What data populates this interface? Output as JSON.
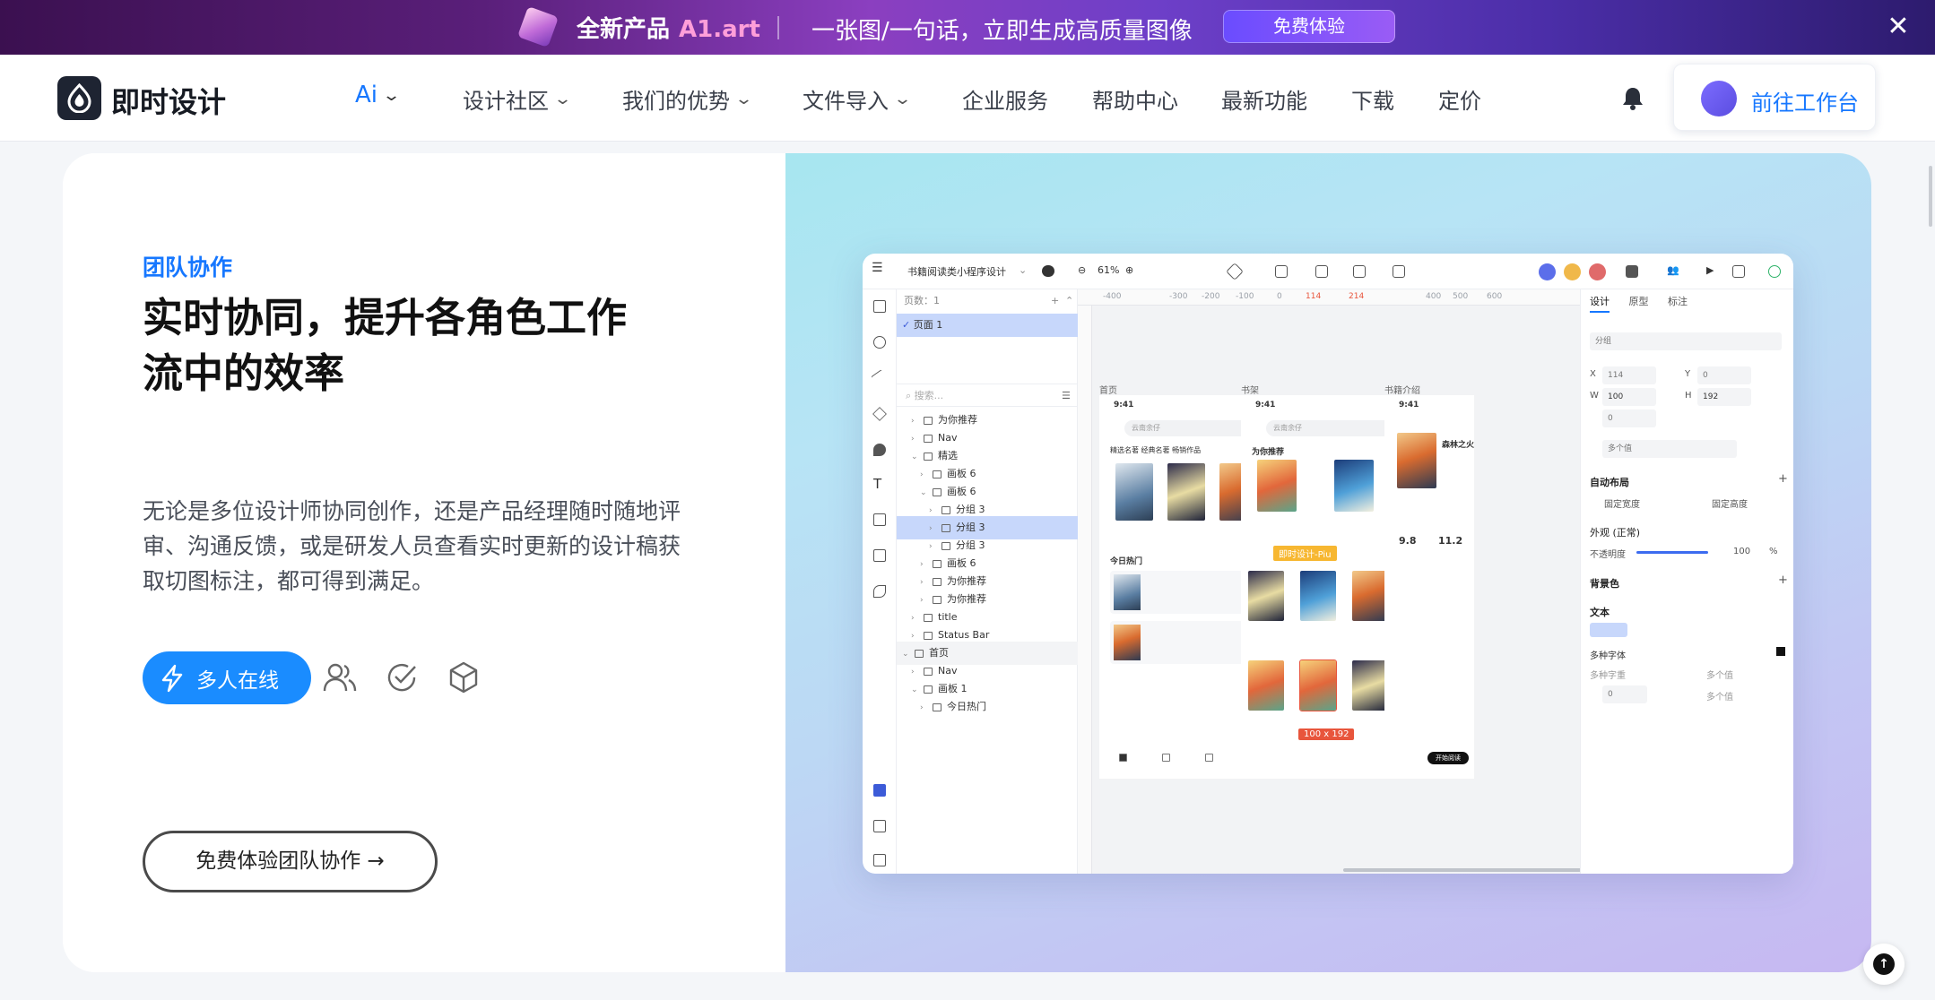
{
  "promo": {
    "title": "全新产品",
    "brand": "A1.art",
    "slogan": "一张图/一句话，立即生成高质量图像",
    "button": "免费体验"
  },
  "nav": {
    "logo_text": "即时设计",
    "items": [
      {
        "label": "Ai",
        "dropdown": true
      },
      {
        "label": "设计社区",
        "dropdown": true
      },
      {
        "label": "我们的优势",
        "dropdown": true
      },
      {
        "label": "文件导入",
        "dropdown": true
      },
      {
        "label": "企业服务",
        "dropdown": false
      },
      {
        "label": "帮助中心",
        "dropdown": false
      },
      {
        "label": "最新功能",
        "dropdown": false
      },
      {
        "label": "下载",
        "dropdown": false
      },
      {
        "label": "定价",
        "dropdown": false
      }
    ],
    "workbench": "前往工作台",
    "accent": "#1677ff"
  },
  "hero": {
    "eyebrow": "团队协作",
    "headline": "实时协同，提升各角色工作流中的效率",
    "description": "无论是多位设计师协同创作，还是产品经理随时随地评审、沟通反馈，或是研发人员查看实时更新的设计稿获取切图标注，都可得到满足。",
    "online_button": "多人在线",
    "feature_icons": [
      "users-icon",
      "check-circle-icon",
      "cube-icon"
    ],
    "cta": "免费体验团队协作 →"
  },
  "app": {
    "file_title": "书籍阅读类小程序设计",
    "zoom": "61%",
    "pages_label": "页数：1",
    "page_1": "页面 1",
    "search_placeholder": "搜索...",
    "layers": [
      {
        "label": "为你推荐",
        "indent": 1
      },
      {
        "label": "Nav",
        "indent": 1
      },
      {
        "label": "精选",
        "indent": 1
      },
      {
        "label": "画板 6",
        "indent": 2
      },
      {
        "label": "画板 6",
        "indent": 2
      },
      {
        "label": "分组 3",
        "indent": 3
      },
      {
        "label": "分组 3",
        "indent": 3,
        "selected": true
      },
      {
        "label": "分组 3",
        "indent": 3
      },
      {
        "label": "画板 6",
        "indent": 2
      },
      {
        "label": "为你推荐",
        "indent": 2
      },
      {
        "label": "为你推荐",
        "indent": 2
      },
      {
        "label": "title",
        "indent": 1
      },
      {
        "label": "Status Bar",
        "indent": 1
      },
      {
        "label": "首页",
        "indent": 0
      },
      {
        "label": "Nav",
        "indent": 1
      },
      {
        "label": "画板 1",
        "indent": 1
      },
      {
        "label": "今日热门",
        "indent": 2
      }
    ],
    "ruler_marks": [
      "-400",
      "-300",
      "-200",
      "-100",
      "0",
      "114",
      "214",
      "400",
      "500",
      "600"
    ],
    "frames": [
      "首页",
      "书架",
      "书籍介绍"
    ],
    "phone_time": "9:41",
    "phone1": {
      "search": "云南余仔",
      "tabs": "精选名著  经典名著  畅销作品",
      "hot": "今日热门"
    },
    "phone2": {
      "search": "云南余仔",
      "recommend": "为你推荐",
      "collab_tag": "即时设计-Piu",
      "size_tag": "100 x 192"
    },
    "phone3": {
      "book_title": "森林之火",
      "rating": "9.8",
      "count": "11.2",
      "bottom_btn": "开始阅读"
    },
    "props": {
      "tabs": [
        "设计",
        "原型",
        "标注"
      ],
      "group": "分组",
      "x": "114",
      "y": "0",
      "w": "100",
      "h": "192",
      "rotation": "0",
      "radius_placeholder": "多个值",
      "auto_layout": "自动布局",
      "fixed_width": "固定宽度",
      "fixed_height": "固定高度",
      "appearance": "外观 (正常)",
      "opacity_label": "不透明度",
      "opacity": "100",
      "opacity_unit": "%",
      "background": "背景色",
      "text": "文本",
      "font": "多种字体",
      "font_weight": "多种字重",
      "multi_value": "多个值",
      "line_height": "0"
    }
  }
}
